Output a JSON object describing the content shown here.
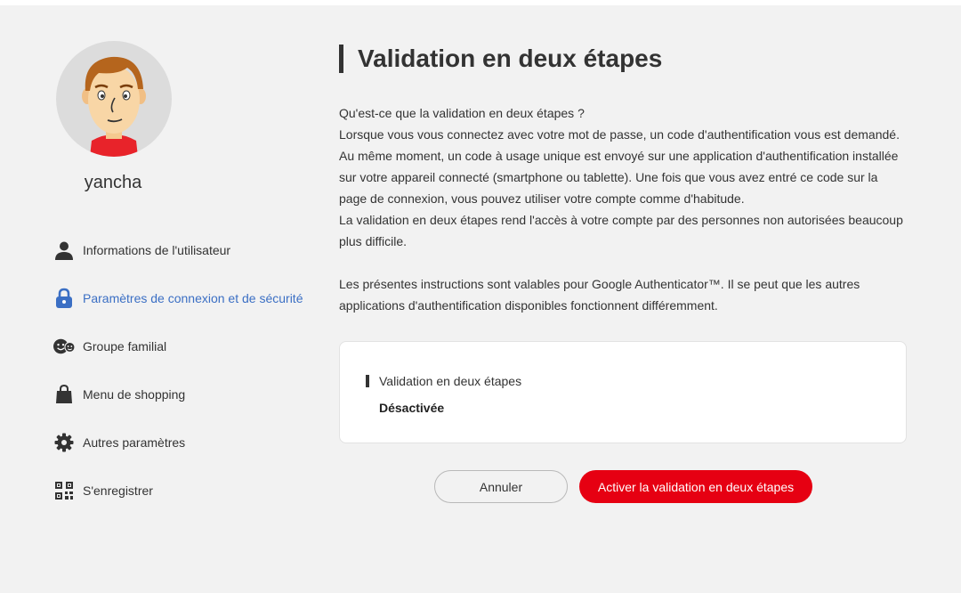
{
  "user": {
    "name": "yancha"
  },
  "sidebar": {
    "items": [
      {
        "label": "Informations de l'utilisateur",
        "icon": "person-icon",
        "active": false
      },
      {
        "label": "Paramètres de connexion et de sécurité",
        "icon": "lock-icon",
        "active": true
      },
      {
        "label": "Groupe familial",
        "icon": "family-icon",
        "active": false
      },
      {
        "label": "Menu de shopping",
        "icon": "shopping-bag-icon",
        "active": false
      },
      {
        "label": "Autres paramètres",
        "icon": "gear-icon",
        "active": false
      },
      {
        "label": "S'enregistrer",
        "icon": "qr-code-icon",
        "active": false
      }
    ]
  },
  "main": {
    "title": "Validation en deux étapes",
    "description": {
      "question": "Qu'est-ce que la validation en deux étapes ?",
      "p1": "Lorsque vous vous connectez avec votre mot de passe, un code d'authentification vous est demandé.",
      "p2": "Au même moment, un code à usage unique est envoyé sur une application d'authentification installée sur votre appareil connecté (smartphone ou tablette). Une fois que vous avez entré ce code sur la page de connexion, vous pouvez utiliser votre compte comme d'habitude.",
      "p3": "La validation en deux étapes rend l'accès à votre compte par des personnes non autorisées beaucoup plus difficile.",
      "p4": "Les présentes instructions sont valables pour Google Authenticator™. Il se peut que les autres applications d'authentification disponibles fonctionnent différemment."
    },
    "status_card": {
      "label": "Validation en deux étapes",
      "value": "Désactivée"
    },
    "buttons": {
      "cancel": "Annuler",
      "activate": "Activer la validation en deux étapes"
    }
  },
  "colors": {
    "accent_blue": "#3b6fc4",
    "primary_red": "#e60012",
    "background": "#f2f2f2"
  }
}
